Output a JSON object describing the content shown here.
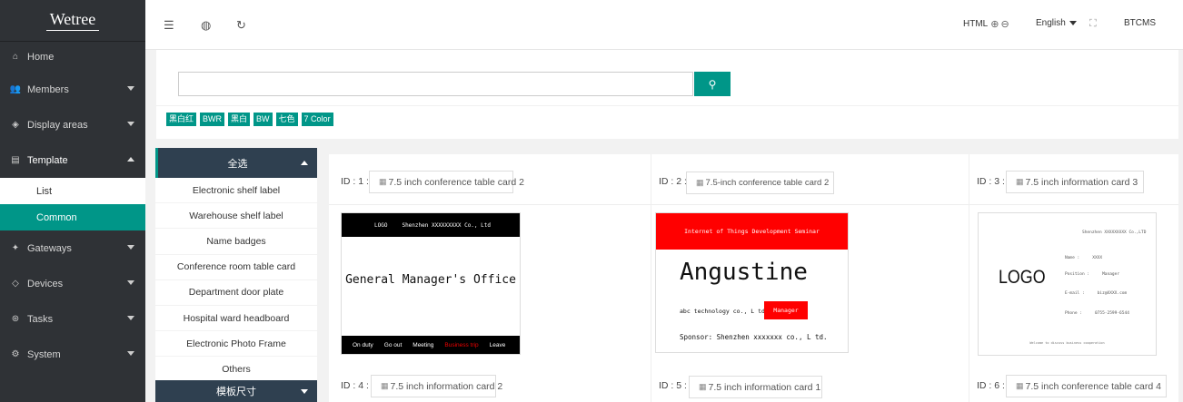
{
  "sidebar": {
    "logo": "Wetree",
    "items": [
      {
        "label": "Home"
      },
      {
        "label": "Members"
      },
      {
        "label": "Display areas"
      },
      {
        "label": "Template"
      },
      {
        "label": "Gateways"
      },
      {
        "label": "Devices"
      },
      {
        "label": "Tasks"
      },
      {
        "label": "System"
      }
    ],
    "submenu": [
      {
        "label": "List"
      },
      {
        "label": "Common"
      }
    ]
  },
  "topbar": {
    "html_label": "HTML",
    "language": "English",
    "user": "BTCMS",
    "zoom_in_icon": "⊕",
    "zoom_out_icon": "⊖"
  },
  "search": {
    "placeholder": "",
    "tags": [
      "黑白红",
      "BWR",
      "黑白",
      "BW",
      "七色",
      "7 Color"
    ]
  },
  "categories": {
    "select_all": "全选",
    "items": [
      "Electronic shelf label",
      "Warehouse shelf label",
      "Name badges",
      "Conference room table card",
      "Department door plate",
      "Hospital ward headboard",
      "Electronic Photo Frame",
      "Others"
    ],
    "footer": "模板尺寸"
  },
  "cards": [
    {
      "id_label": "ID : 1 :",
      "name": "7.5 inch conference table card 2"
    },
    {
      "id_label": "ID : 2 :",
      "name": "7.5-inch conference table card 2"
    },
    {
      "id_label": "ID : 3 :",
      "name": "7.5 inch information card 3"
    },
    {
      "id_label": "ID : 4 :",
      "name": "7.5 inch information card 2"
    },
    {
      "id_label": "ID : 5 :",
      "name": "7.5 inch information card 1"
    },
    {
      "id_label": "ID : 6 :",
      "name": "7.5 inch conference table card 4"
    }
  ],
  "preview1": {
    "logo": "LOGO",
    "company": "Shenzhen XXXXXXXXX Co., Ltd",
    "title": "General Manager's Office",
    "status": [
      "On duty",
      "Go out",
      "Meeting",
      "Business trip",
      "Leave"
    ]
  },
  "preview2": {
    "header": "Internet of Things Development Seminar",
    "name": "Angustine",
    "company": "abc technology co., L td.",
    "badge": "Manager",
    "sponsor": "Sponsor: Shenzhen xxxxxxx  co., L td."
  },
  "preview3": {
    "company": "Shenzhen XXXXXXXXX Co.,LTD",
    "logo": "LOGO",
    "rows": [
      {
        "k": "Name :",
        "v": "XXXX"
      },
      {
        "k": "Position :",
        "v": "Manager"
      },
      {
        "k": "E-mail :",
        "v": "biz@XXXX.com"
      },
      {
        "k": "Phone :",
        "v": "0755-2599-6544"
      }
    ],
    "footer": "Welcome to discuss business cooperation"
  },
  "colors": {
    "accent": "#009688",
    "sidebar_bg": "#2f3236",
    "category_head": "#2f4050",
    "preview_red": "#ff0000"
  }
}
